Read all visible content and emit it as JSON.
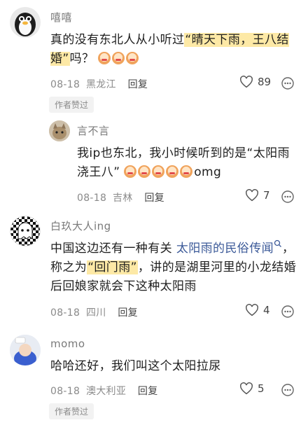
{
  "comments": [
    {
      "user": "嘻嘻",
      "text_before": "真的没有东北人从小听过",
      "text_quote": "“晴天下雨，王八结婚”",
      "text_after": "吗？",
      "emojis": 3,
      "date": "08-18",
      "location": "黑龙江",
      "reply_label": "回复",
      "likes": "89",
      "badge": "作者赞过"
    },
    {
      "user": "言不言",
      "text": "我ip也东北，我小时候听到的是“太阳雨浇王八”",
      "emojis": 5,
      "text_tail": "omg",
      "date": "08-18",
      "location": "吉林",
      "reply_label": "回复",
      "likes": "7"
    },
    {
      "user": "白玖大人ing",
      "text_a": "中国这边还有一种有关",
      "link_text": "太阳雨的民俗传闻",
      "text_b": "，称之为",
      "text_hl": "“回门雨”",
      "text_c": "，讲的是湖里河里的小龙结婚后回娘家就会下这种太阳雨",
      "date": "08-18",
      "location": "四川",
      "reply_label": "回复",
      "likes": "4"
    },
    {
      "user": "momo",
      "text": "哈哈还好，我们叫这个太阳拉尿",
      "date": "08-18",
      "location": "澳大利亚",
      "reply_label": "回复",
      "likes": "5",
      "badge": "作者赞过"
    }
  ],
  "colors": {
    "highlight": "#fde9a6",
    "link": "#3b5998"
  },
  "icons": {
    "like": "heart-outline-icon",
    "more": "more-dots-icon",
    "search": "search-icon"
  }
}
